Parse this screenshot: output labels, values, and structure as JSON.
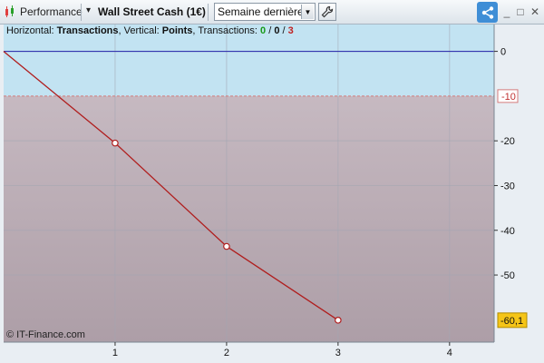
{
  "toolbar": {
    "performance_label": "Performance",
    "instrument_label": "Wall Street Cash (1€)",
    "instrument_arrow": "▾",
    "period_selected": "Semaine dernière",
    "icons": {
      "performance": "candlestick-icon",
      "settings": "wrench-icon",
      "share": "share-icon",
      "minimize": "minimize-icon",
      "maximize": "maximize-icon",
      "close": "close-icon"
    },
    "window_buttons": [
      "_",
      "□",
      "✕"
    ]
  },
  "info_bar": {
    "horizontal_prefix": "Horizontal: ",
    "horizontal_value": "Transactions",
    "vertical_prefix": ", Vertical: ",
    "vertical_value": "Points",
    "transactions_prefix": ", Transactions: ",
    "tx_win": "0",
    "tx_sep1": " / ",
    "tx_neutral": "0",
    "tx_sep2": " / ",
    "tx_loss": "3"
  },
  "copyright": "© IT-Finance.com",
  "colors": {
    "profit_zone": "#c2e3f2",
    "loss_zone": "#b9a9b2",
    "line": "#b01e1e",
    "zero_line": "#2222aa",
    "threshold": "#d47b7b",
    "win": "#1a9a1a",
    "loss": "#c02020",
    "last_badge": "#f5c518"
  },
  "chart_data": {
    "type": "line",
    "x": [
      0,
      1,
      2,
      3
    ],
    "y": [
      0,
      -20.5,
      -43.6,
      -60.1
    ],
    "xticks": [
      "1",
      "2",
      "3",
      "4"
    ],
    "yticks": [
      "0",
      "-20",
      "-30",
      "-40",
      "-50"
    ],
    "xlim": [
      0,
      4.4
    ],
    "ylim": [
      -65,
      6
    ],
    "threshold_value": -10,
    "threshold_label": "-10",
    "last_value_label": "-60,1",
    "grid": true
  }
}
